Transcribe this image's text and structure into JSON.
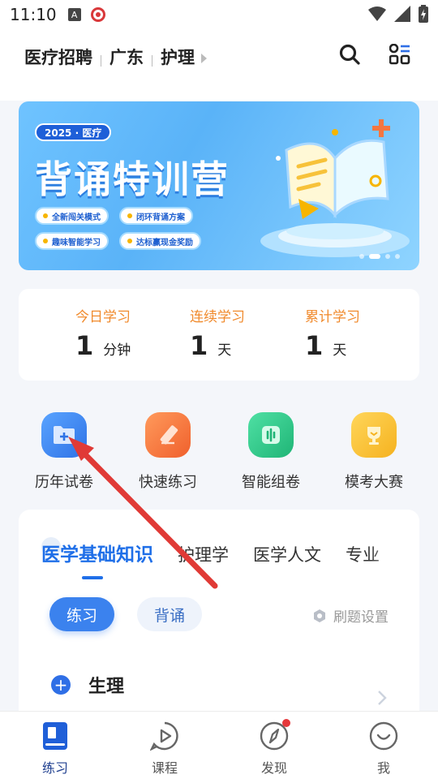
{
  "status_bar": {
    "time": "11:10",
    "a_icon": "A"
  },
  "header": {
    "breadcrumbs": [
      "医疗招聘",
      "广东",
      "护理"
    ]
  },
  "banner": {
    "tag": "2025 · 医疗",
    "title": "背诵特训营",
    "chips": [
      "全新闯关模式",
      "闭环背诵方案",
      "趣味智能学习",
      "达标赢现金奖励"
    ],
    "colors": {
      "bg": "#5ab3f8",
      "tag_bg": "#1e5fd8"
    }
  },
  "stats": [
    {
      "label": "今日学习",
      "value": "1",
      "unit": "分钟"
    },
    {
      "label": "连续学习",
      "value": "1",
      "unit": "天"
    },
    {
      "label": "累计学习",
      "value": "1",
      "unit": "天"
    }
  ],
  "features": [
    {
      "label": "历年试卷",
      "icon": "folder-plus-icon",
      "color": "#3d86ee"
    },
    {
      "label": "快速练习",
      "icon": "pencil-icon",
      "color": "#f47640"
    },
    {
      "label": "智能组卷",
      "icon": "audio-wave-icon",
      "color": "#2fcb8c"
    },
    {
      "label": "模考大赛",
      "icon": "trophy-icon",
      "color": "#f7c130"
    }
  ],
  "panel": {
    "tabs": [
      "医学基础知识",
      "护理学",
      "医学人文",
      "专业"
    ],
    "active_tab": 0,
    "mode_buttons": {
      "practice": "练习",
      "recite": "背诵"
    },
    "settings_label": "刷题设置",
    "subject": {
      "name": "生理"
    }
  },
  "bottom_nav": [
    {
      "label": "练习",
      "icon": "book-icon",
      "active": true
    },
    {
      "label": "课程",
      "icon": "play-bubble-icon",
      "active": false
    },
    {
      "label": "发现",
      "icon": "compass-icon",
      "active": false,
      "badge": true
    },
    {
      "label": "我",
      "icon": "smile-icon",
      "active": false
    }
  ],
  "accent_color": "#1f6fe8"
}
